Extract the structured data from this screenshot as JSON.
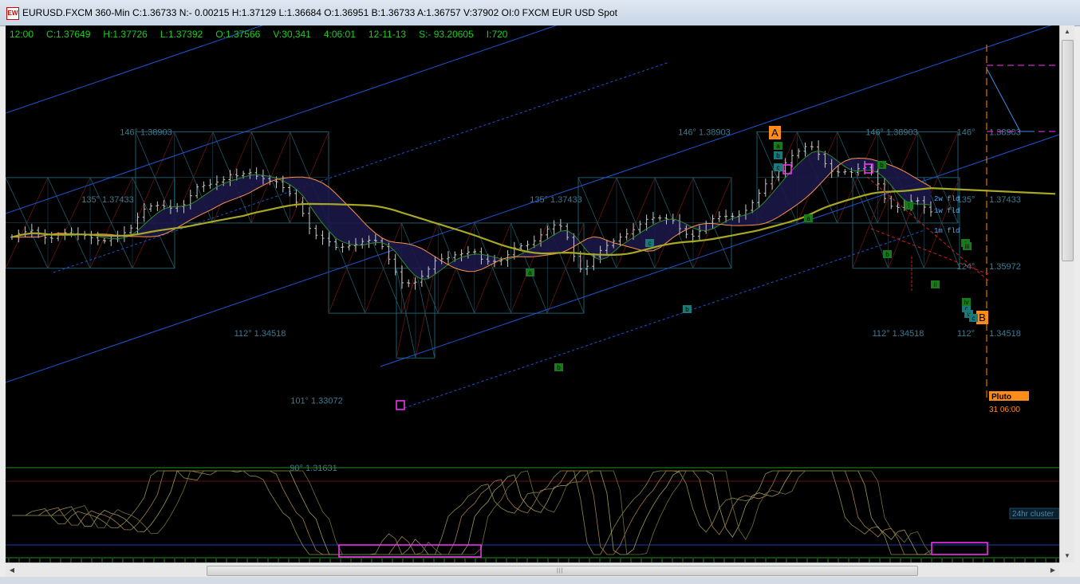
{
  "window": {
    "title": "EURUSD.FXCM 360-Min C:1.36733 N:- 0.00215 H:1.37129 L:1.36684 O:1.36951 B:1.36733 A:1.36757 V:37902 OI:0 FXCM EUR USD Spot",
    "icon_name": "app-logo-icon"
  },
  "info_bar": {
    "time": "12:00",
    "close": "C:1.37649",
    "high": "H:1.37726",
    "low": "L:1.37392",
    "open": "O:1.37566",
    "volume": "V:30,341",
    "clock": "4:06:01",
    "date": "12-11-13",
    "s_value": "S:- 93.20605",
    "i_value": "I:720"
  },
  "chart_data": {
    "type": "line",
    "symbol": "EURUSD.FXCM",
    "interval": "360-Min",
    "price_levels": [
      {
        "label": "146°  1.38903",
        "value": 1.38903
      },
      {
        "label": "135°  1.37433",
        "value": 1.37433
      },
      {
        "label": "124°  1.35972",
        "value": 1.35972
      },
      {
        "label": "112°  1.34518",
        "value": 1.34518
      },
      {
        "label": "101°  1.33072",
        "value": 1.33072
      },
      {
        "label": "90°  1.31631",
        "value": 1.31631
      }
    ],
    "right_price_labels": [
      "1.38903",
      "1.37433",
      "1.35972",
      "1.34518"
    ],
    "right_degree_labels": [
      "146°",
      "135°",
      "124°",
      "112°"
    ],
    "close_series": [
      1.3552,
      1.3563,
      1.3569,
      1.3574,
      1.3562,
      1.355,
      1.3548,
      1.3559,
      1.3566,
      1.3563,
      1.3561,
      1.3557,
      1.355,
      1.3541,
      1.354,
      1.3546,
      1.3555,
      1.3566,
      1.3581,
      1.3616,
      1.3642,
      1.3652,
      1.3654,
      1.3651,
      1.3645,
      1.365,
      1.3656,
      1.3685,
      1.3714,
      1.3718,
      1.3722,
      1.3729,
      1.3737,
      1.3753,
      1.3749,
      1.3756,
      1.3759,
      1.3748,
      1.374,
      1.3732,
      1.373,
      1.3711,
      1.3692,
      1.3664,
      1.3628,
      1.358,
      1.3558,
      1.3548,
      1.3537,
      1.3519,
      1.352,
      1.3524,
      1.3528,
      1.3538,
      1.3542,
      1.354,
      1.3521,
      1.3481,
      1.344,
      1.3405,
      1.3404,
      1.3407,
      1.3426,
      1.3449,
      1.3476,
      1.3482,
      1.3486,
      1.3495,
      1.3498,
      1.3504,
      1.3505,
      1.3481,
      1.3474,
      1.3474,
      1.3477,
      1.3495,
      1.3517,
      1.3524,
      1.3528,
      1.354,
      1.3559,
      1.3578,
      1.3591,
      1.3587,
      1.3551,
      1.349,
      1.3449,
      1.3458,
      1.3489,
      1.3509,
      1.3525,
      1.3539,
      1.3552,
      1.3562,
      1.3576,
      1.3594,
      1.3609,
      1.3614,
      1.3613,
      1.361,
      1.3605,
      1.3579,
      1.3561,
      1.3555,
      1.3571,
      1.3596,
      1.3611,
      1.3618,
      1.3619,
      1.3619,
      1.3623,
      1.3638,
      1.3663,
      1.3693,
      1.3723,
      1.3745,
      1.3764,
      1.3791,
      1.3814,
      1.3828,
      1.3843,
      1.3842,
      1.3818,
      1.3788,
      1.3763,
      1.3761,
      1.3762,
      1.376,
      1.3772,
      1.3776,
      1.3763,
      1.3723,
      1.3676,
      1.3651,
      1.3647,
      1.3656,
      1.3668,
      1.3669,
      1.3648,
      1.3633
    ],
    "wave_labels": [
      {
        "text": "A",
        "color": "#ff8c1a"
      },
      {
        "text": "B",
        "color": "#ff8c1a"
      },
      {
        "text": "a"
      },
      {
        "text": "b"
      },
      {
        "text": "c"
      },
      {
        "text": "a"
      },
      {
        "text": "b"
      },
      {
        "text": "c"
      },
      {
        "text": "b"
      },
      {
        "text": "a"
      },
      {
        "text": "b"
      },
      {
        "text": "c"
      },
      {
        "text": "a"
      },
      {
        "text": "b"
      },
      {
        "text": "i"
      },
      {
        "text": "ii"
      },
      {
        "text": "iii"
      },
      {
        "text": "iv"
      },
      {
        "text": "v"
      },
      {
        "text": "c"
      },
      {
        "text": "i"
      },
      {
        "text": "i"
      },
      {
        "text": "ii"
      }
    ],
    "fld_labels": [
      "2w fld",
      "1w fld",
      "1m fld"
    ],
    "planet_marker": {
      "label": "Pluto",
      "time": "31  06:00"
    },
    "oscillator_label": "24hr cluster",
    "grid": false,
    "ylim": [
      1.3125,
      1.3975
    ]
  },
  "colors": {
    "background": "#000000",
    "info_text": "#17d117",
    "gann_box": "#1d5b6b",
    "gann_diag": "#6b1212",
    "channel": "#1f55d6",
    "price_bars": "#c8c8c8",
    "fast_ma": "#ff9244",
    "slow_ma": "#a8a825",
    "cloud_fill": "#1c1748",
    "marker_pink": "#ff33ff",
    "wave_green": "#197a19",
    "wave_teal": "#1a7a7a",
    "orange": "#ff8c1a",
    "level_label": "#3f7a8f"
  },
  "scrollbars": {
    "up_icon": "scroll-up-arrow-icon",
    "down_icon": "scroll-down-arrow-icon",
    "left_icon": "scroll-left-arrow-icon",
    "right_icon": "scroll-right-arrow-icon"
  }
}
